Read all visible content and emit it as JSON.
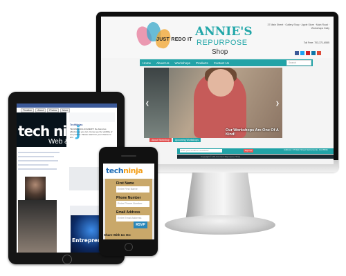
{
  "monitor_site": {
    "tagline": "JUST REDO IT",
    "logo_line1": "ANNIE'S",
    "logo_line2": "REPURPOSE",
    "logo_line3": "Shop",
    "address_lines": "37 Main Street · Gallery Shop · Apple Store · Main Road · Workshops Daily",
    "phone_line": "Toll Free: 703-371-6555",
    "nav": [
      "Home",
      "About Us",
      "Workshops",
      "Products",
      "Contact Us"
    ],
    "search_placeholder": "Search",
    "hero_caption": "Our Workshops Are One Of A Kind!",
    "hero_tabs": [
      "About Workshop",
      "Upcoming Workshops"
    ],
    "footer_input_placeholder": "Enter your email for newsletter",
    "footer_button": "Sign Up",
    "footer_text": "Address: 37 Main Street Sacramento, CA 95811",
    "copyright": "Copyright © 2014 Annie's Repurpose Shop"
  },
  "tablet_site": {
    "tabs": [
      "Timeline",
      "About",
      "Photos",
      "More"
    ],
    "brand": "tech nin",
    "brand_accent": "j",
    "subbrand": "Web & I",
    "post_title": "TechNinjas",
    "post_text": "TECHNINJAS ACADEMY! Re-brand as effective as you can. Come see the visibility of our product. Please watch for your chance to win.",
    "entre_text": "Entrepreneur"
  },
  "phone_site": {
    "logo": "tech",
    "logo_accent": "ninja",
    "first_name_label": "First Name",
    "first_name_placeholder": "Enter First Name",
    "phone_label": "Phone Number",
    "phone_placeholder": "Enter Phone Number",
    "email_label": "Email Address",
    "email_placeholder": "Enter Email Address",
    "rsvp": "RSVP",
    "share": "Share With Us On:"
  },
  "colors": {
    "teal": "#22a3a7",
    "facebook_blue": "#3b5998",
    "form_gold": "#c9a86a",
    "rsvp_blue": "#2a87b9"
  }
}
